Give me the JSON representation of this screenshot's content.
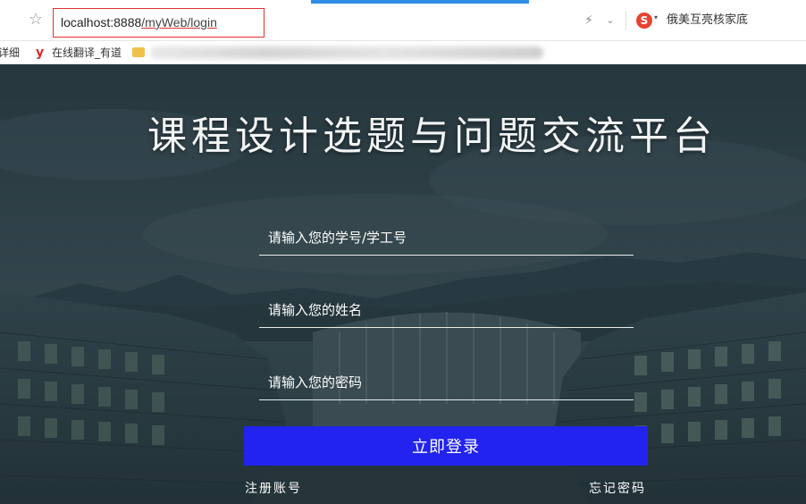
{
  "browser": {
    "url_host": "localhost:8888",
    "url_path": "/myWeb/login",
    "search_hint": "俄美互亮核家底",
    "bookmarks": {
      "partial_left": "详细",
      "youdao_label": "在线翻译_有道"
    }
  },
  "page": {
    "title": "课程设计选题与问题交流平台",
    "fields": {
      "student_id_placeholder": "请输入您的学号/学工号",
      "name_placeholder": "请输入您的姓名",
      "password_placeholder": "请输入您的密码"
    },
    "login_button": "立即登录",
    "register_link": "注册账号",
    "forgot_link": "忘记密码"
  },
  "colors": {
    "login_button": "#2323f0",
    "url_highlight": "#e0312f",
    "tab_accent": "#2f8de4"
  },
  "icons": [
    "star-icon",
    "flash-icon",
    "dropdown-icon",
    "sogou-icon",
    "youdao-icon",
    "folder-icon"
  ]
}
